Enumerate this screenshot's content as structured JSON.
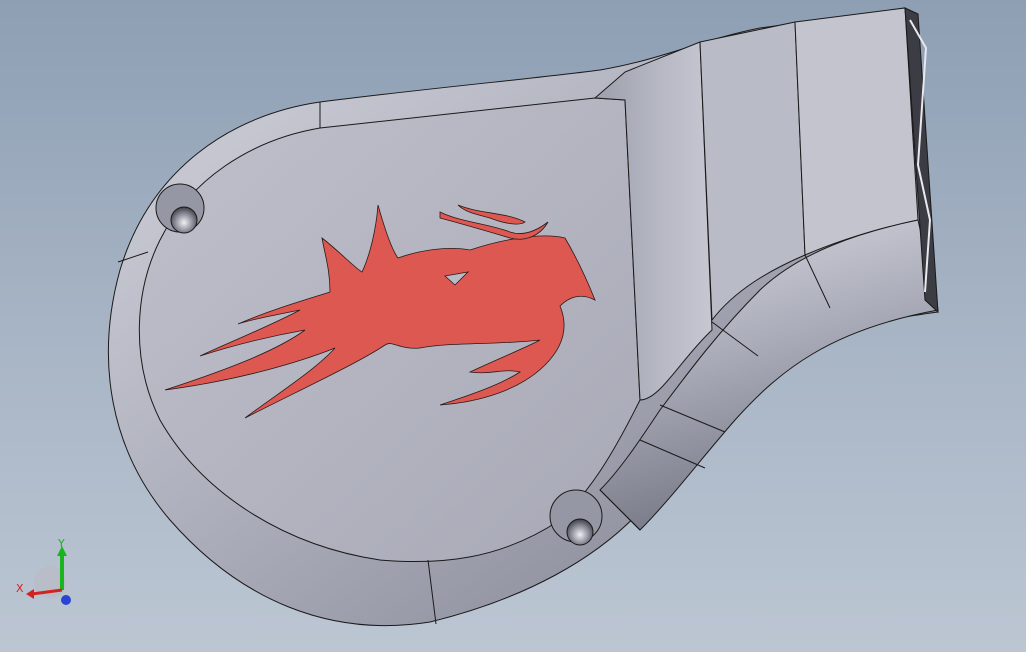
{
  "viewport": {
    "background_top": "#8e9fb4",
    "background_bottom": "#bcc6d3"
  },
  "model": {
    "surface_color": "#b3b5c2",
    "edge_color": "#1a1a1a",
    "decal_color": "#dd5850"
  },
  "triad": {
    "x_label": "X",
    "y_label": "Y",
    "x_color": "#d22323",
    "y_color": "#19b41e",
    "z_color": "#2846d2"
  }
}
